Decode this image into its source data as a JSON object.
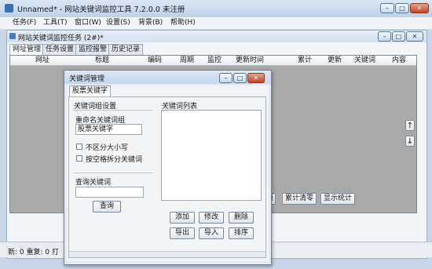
{
  "main_window": {
    "title": "Unnamed* - 网站关键词监控工具 7.2.0.0  未注册",
    "controls": {
      "minimize": "–",
      "maximize": "□",
      "close": "✕"
    }
  },
  "menu": [
    "任务(F)",
    "工具(T)",
    "窗口(W)",
    "设置(S)",
    "背景(B)",
    "帮助(H)"
  ],
  "mdi_child": {
    "title": "网站关键词监控任务 (2#)*",
    "tabs": [
      "网址管理",
      "任务设置",
      "监控报警",
      "历史记录"
    ],
    "columns": [
      "网址",
      "标题",
      "编码",
      "周期",
      "监控",
      "更新时间",
      "累计",
      "更新",
      "关键词",
      "内容"
    ],
    "side_buttons": [
      "↑",
      "↓"
    ],
    "bottom_buttons": [
      "页",
      "累计清零",
      "显示统计"
    ]
  },
  "status_bar": {
    "text": "新: 0  重复: 0  打"
  },
  "dialog": {
    "title": "关键词管理",
    "tab": "股票关键字",
    "group_settings": "关键词组设置",
    "rename_label": "重命名关键词组",
    "rename_value": "股票关键字",
    "check_case": "不区分大小写",
    "check_split": "按空格拆分关键词",
    "query_label": "查询关键词",
    "query_value": "",
    "query_button": "查询",
    "list_label": "关键词列表",
    "buttons": [
      "添加",
      "修改",
      "删除",
      "导出",
      "导入",
      "排序"
    ]
  }
}
